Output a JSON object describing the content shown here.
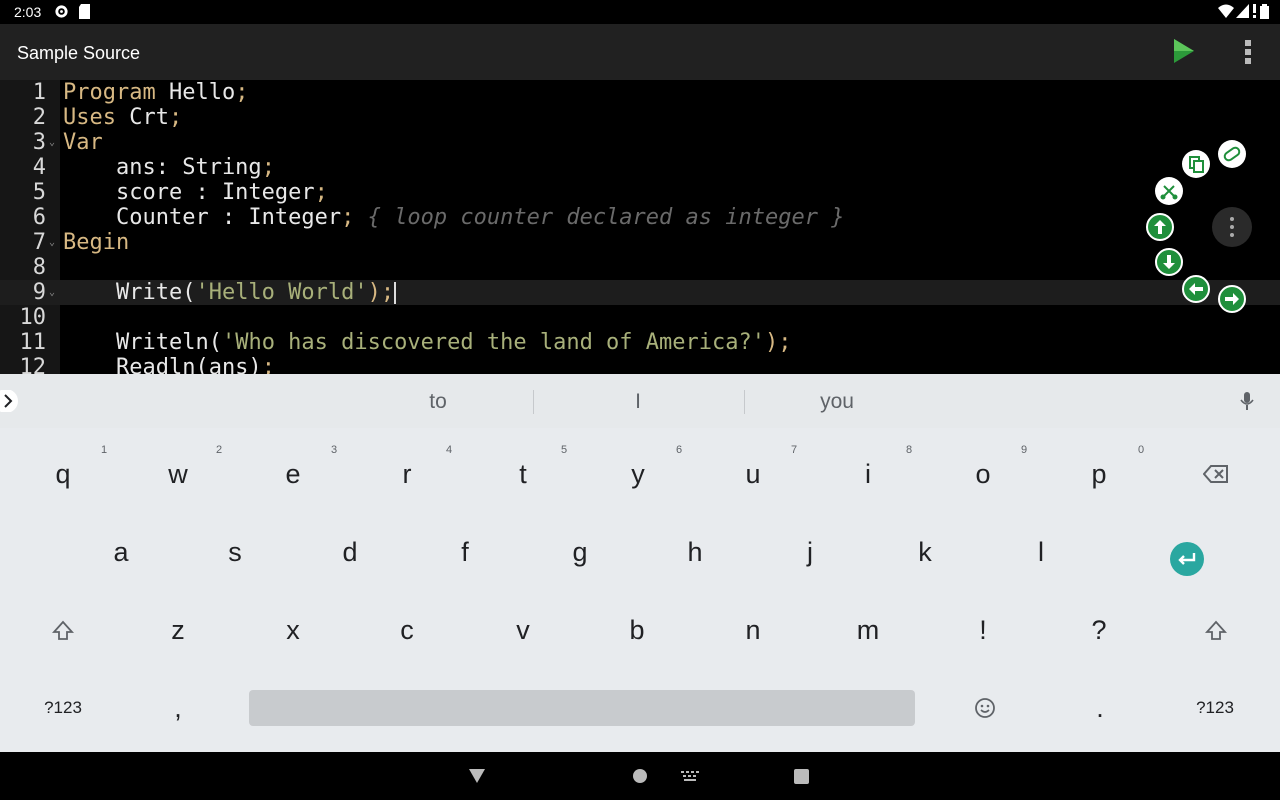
{
  "status_bar": {
    "time": "2:03"
  },
  "app_bar": {
    "title": "Sample Source"
  },
  "editor": {
    "lines": [
      {
        "n": "1"
      },
      {
        "n": "2"
      },
      {
        "n": "3"
      },
      {
        "n": "4"
      },
      {
        "n": "5"
      },
      {
        "n": "6"
      },
      {
        "n": "7"
      },
      {
        "n": "8"
      },
      {
        "n": "9"
      },
      {
        "n": "10"
      },
      {
        "n": "11"
      },
      {
        "n": "12"
      }
    ],
    "code": {
      "l1_kw": "Program",
      "l1_id": " Hello",
      "l1_p": ";",
      "l2_kw": "Uses",
      "l2_id": " Crt",
      "l2_p": ";",
      "l3_kw": "Var",
      "l4_id": "    ans: String",
      "l4_p": ";",
      "l5_id": "    score : Integer",
      "l5_p": ";",
      "l6_id": "    Counter : Integer",
      "l6_p": ";",
      "l6_cm": " { loop counter declared as integer }",
      "l7_kw": "Begin",
      "l9_id": "    Write(",
      "l9_str": "'Hello World'",
      "l9_p": ");",
      "l11_id": "    Writeln(",
      "l11_str": "'Who has discovered the land of America?'",
      "l11_p": ");",
      "l12_id": "    Readln(ans)",
      "l12_p": ";"
    }
  },
  "keyboard": {
    "suggestions": [
      "to",
      "I",
      "you"
    ],
    "row1": [
      {
        "k": "q",
        "h": "1"
      },
      {
        "k": "w",
        "h": "2"
      },
      {
        "k": "e",
        "h": "3"
      },
      {
        "k": "r",
        "h": "4"
      },
      {
        "k": "t",
        "h": "5"
      },
      {
        "k": "y",
        "h": "6"
      },
      {
        "k": "u",
        "h": "7"
      },
      {
        "k": "i",
        "h": "8"
      },
      {
        "k": "o",
        "h": "9"
      },
      {
        "k": "p",
        "h": "0"
      }
    ],
    "row2": [
      "a",
      "s",
      "d",
      "f",
      "g",
      "h",
      "j",
      "k",
      "l"
    ],
    "row3": [
      "z",
      "x",
      "c",
      "v",
      "b",
      "n",
      "m",
      "!",
      "?"
    ],
    "row4": {
      "symbols_left": "?123",
      "comma": ",",
      "period": ".",
      "symbols_right": "?123"
    }
  }
}
